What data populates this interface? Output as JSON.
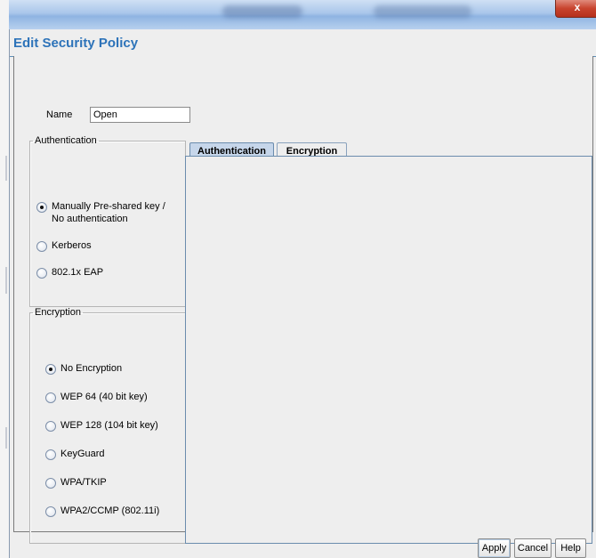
{
  "window": {
    "close_label": "x"
  },
  "header": {
    "title": "Edit Security Policy"
  },
  "name_field": {
    "label": "Name",
    "value": "Open"
  },
  "authentication": {
    "legend": "Authentication",
    "options": [
      {
        "label": "Manually Pre-shared key / No authentication",
        "selected": true
      },
      {
        "label": "Kerberos",
        "selected": false
      },
      {
        "label": "802.1x EAP",
        "selected": false
      }
    ]
  },
  "encryption": {
    "legend": "Encryption",
    "options": [
      {
        "label": "No Encryption",
        "selected": true
      },
      {
        "label": "WEP 64 (40 bit key)",
        "selected": false
      },
      {
        "label": "WEP 128 (104 bit key)",
        "selected": false
      },
      {
        "label": "KeyGuard",
        "selected": false
      },
      {
        "label": "WPA/TKIP",
        "selected": false
      },
      {
        "label": "WPA2/CCMP (802.11i)",
        "selected": false
      }
    ]
  },
  "tabs": [
    {
      "label": "Authentication",
      "active": true
    },
    {
      "label": "Encryption",
      "active": false
    }
  ],
  "buttons": {
    "apply": "Apply",
    "cancel": "Cancel",
    "help": "Help"
  },
  "colors": {
    "title": "#2d73b9",
    "close": "#c8432e",
    "active_tab": "#c6d6ea"
  }
}
